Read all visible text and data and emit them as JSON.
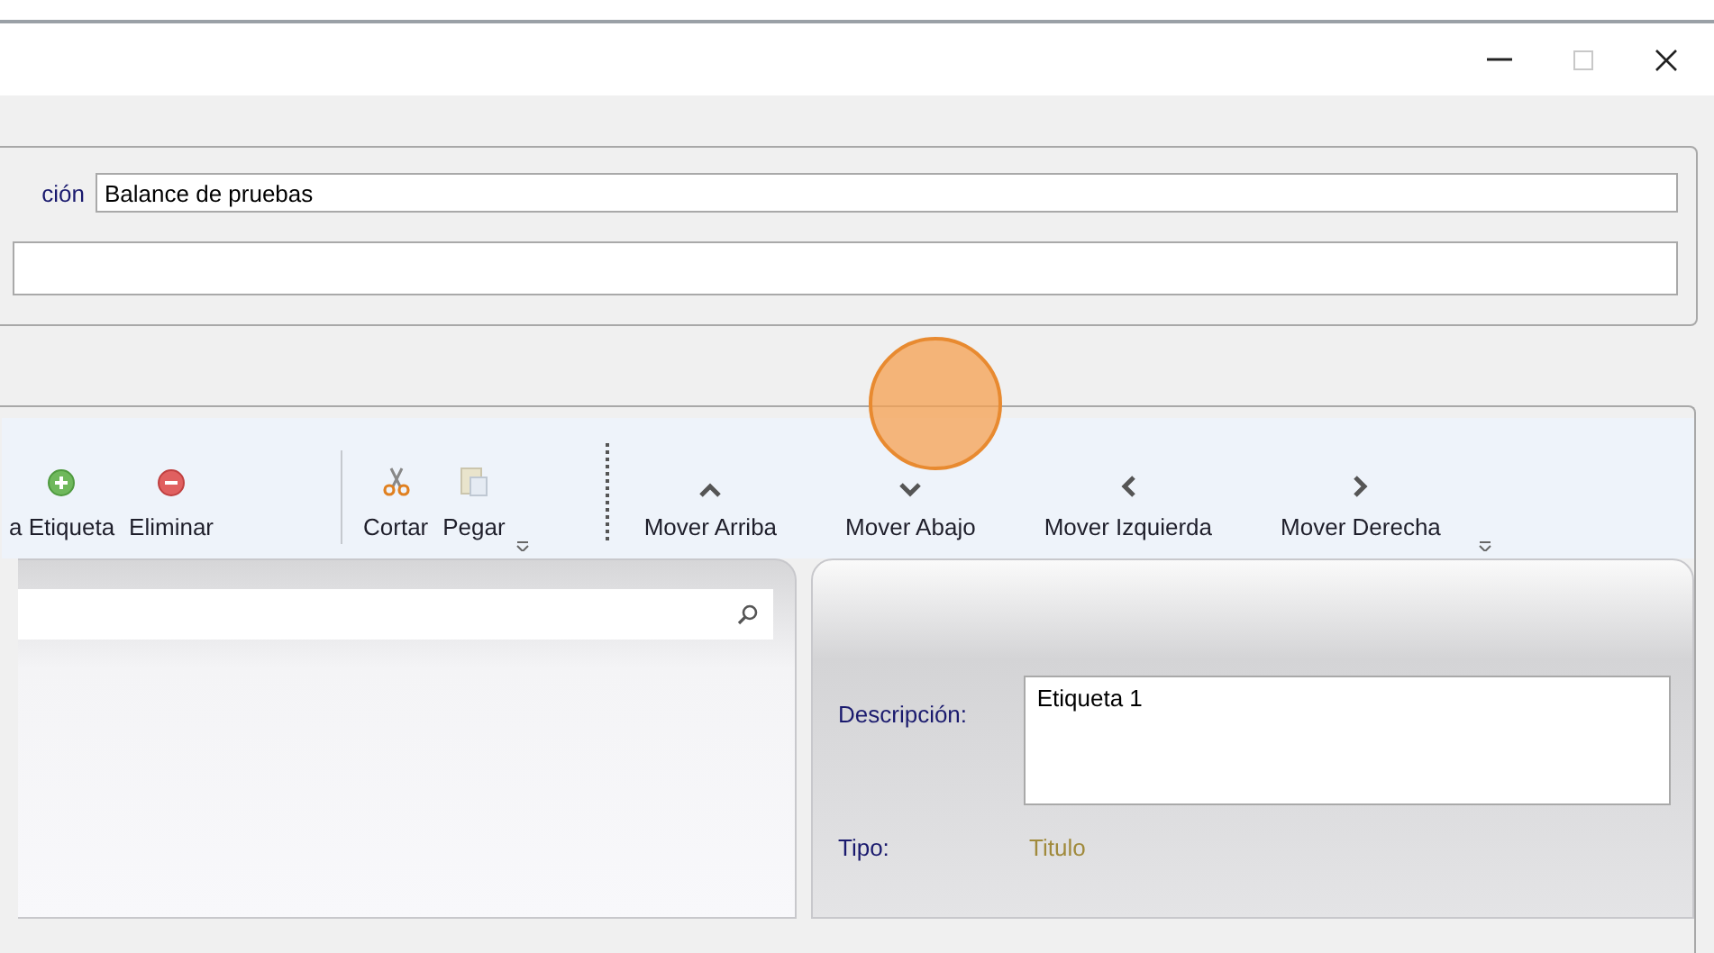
{
  "window": {
    "controls": [
      {
        "kind": "minimize"
      },
      {
        "kind": "maximize",
        "disabled": true
      },
      {
        "kind": "close"
      }
    ]
  },
  "header": {
    "fields": [
      {
        "label": "ción",
        "value": "Balance de pruebas"
      },
      {
        "kind": "wide"
      }
    ]
  },
  "toolbar": {
    "items": [
      {
        "kind": "add",
        "label": "a Etiqueta"
      },
      {
        "kind": "delete",
        "label": "Eliminar"
      },
      {
        "kind": "separator"
      },
      {
        "kind": "cut",
        "label": "Cortar"
      },
      {
        "kind": "paste",
        "label": "Pegar",
        "disabled": true
      },
      {
        "kind": "overflow"
      },
      {
        "kind": "dotted"
      },
      {
        "kind": "up",
        "label": "Mover Arriba"
      },
      {
        "kind": "down",
        "label": "Mover Abajo"
      },
      {
        "kind": "left",
        "label": "Mover Izquierda"
      },
      {
        "kind": "right",
        "label": "Mover Derecha"
      },
      {
        "kind": "overflow"
      }
    ]
  },
  "details": {
    "description_label": "Descripción:",
    "description": "Etiqueta 1",
    "type_label": "Tipo:",
    "type": "Titulo"
  }
}
